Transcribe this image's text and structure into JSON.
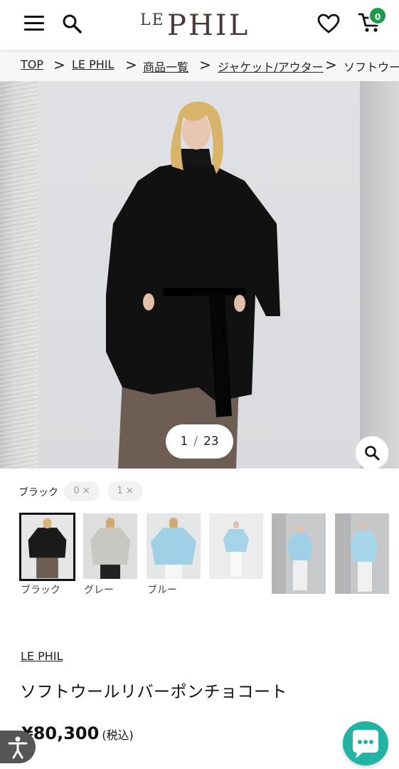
{
  "header": {
    "logo_le": "LE",
    "logo_phil": "PHIL",
    "cart_count": "0"
  },
  "breadcrumb": {
    "items": [
      "TOP",
      "LE PHIL",
      "商品一覧",
      "ジャケット/アウター"
    ],
    "current": "ソフトウール",
    "separator": ">"
  },
  "gallery": {
    "current_index": "1",
    "slash": "/",
    "total": "23"
  },
  "color_select": {
    "selected_color": "ブラック",
    "qty_options": [
      "0",
      "1"
    ],
    "remove_glyph": "×"
  },
  "thumbnails": [
    {
      "label": "ブラック",
      "selected": true,
      "coat_color": "#1a1a1a"
    },
    {
      "label": "グレー",
      "selected": false,
      "coat_color": "#c9c7c2"
    },
    {
      "label": "ブルー",
      "selected": false,
      "coat_color": "#9fd0e6"
    },
    {
      "label": "",
      "selected": false,
      "coat_color": "#a6d3e8"
    },
    {
      "label": "",
      "selected": false,
      "coat_color": "#9fd0e6"
    },
    {
      "label": "",
      "selected": false,
      "coat_color": "#a7d6ea"
    }
  ],
  "product": {
    "brand": "LE PHIL",
    "name": "ソフトウールリバーポンチョコート",
    "price": "¥80,300",
    "tax_note": "(税込)"
  },
  "colors": {
    "accent_green": "#1e9a4b",
    "chat_teal": "#22b3a5",
    "logo_brown": "#4a3a37"
  }
}
